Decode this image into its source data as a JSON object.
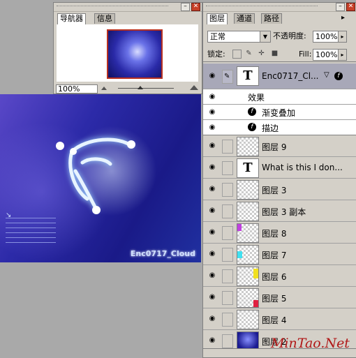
{
  "navigator": {
    "tabs": [
      "导航器",
      "信息"
    ],
    "zoom": "100%"
  },
  "canvas": {
    "signature": "Enc0717_Cloud"
  },
  "layers": {
    "tabs": [
      "图层",
      "通道",
      "路径"
    ],
    "blend_mode": "正常",
    "opacity_label": "不透明度:",
    "opacity_value": "100%",
    "lock_label": "锁定:",
    "fill_label": "Fill:",
    "fill_value": "100%",
    "selected_layer": "Enc0717_Cl...",
    "effects_label": "效果",
    "effects": [
      "渐变叠加",
      "描边"
    ],
    "items": [
      {
        "name": "图层 9",
        "thumb": "transparent"
      },
      {
        "name": "What is this  I don...",
        "thumb": "text"
      },
      {
        "name": "图层 3",
        "thumb": "transparent"
      },
      {
        "name": "图层 3 副本",
        "thumb": "transparent"
      },
      {
        "name": "图层 8",
        "thumb": "transparent"
      },
      {
        "name": "图层 7",
        "thumb": "transparent"
      },
      {
        "name": "图层 6",
        "thumb": "transparent"
      },
      {
        "name": "图层 5",
        "thumb": "transparent"
      },
      {
        "name": "图层 4",
        "thumb": "transparent"
      },
      {
        "name": "图层 2",
        "thumb": "image"
      }
    ]
  },
  "watermark": "MinTao.Net",
  "colors": {
    "accent_red": "#b83020",
    "canvas_blue": "#2c2aa8"
  }
}
